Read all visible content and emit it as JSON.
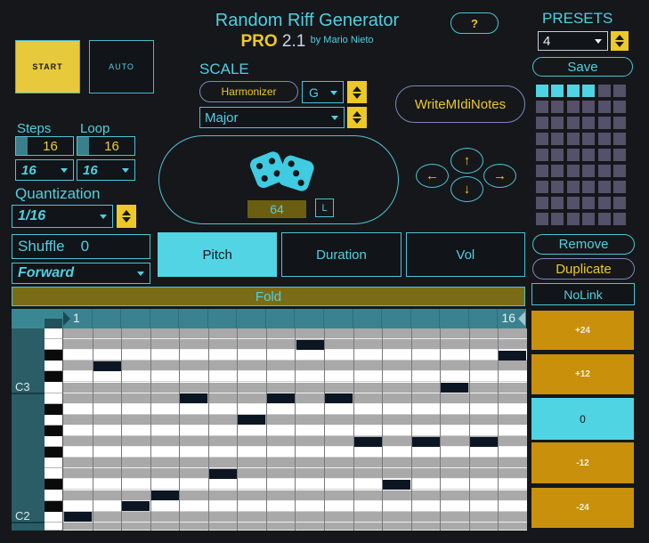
{
  "header": {
    "title": "Random Riff Generator",
    "edition": "PRO",
    "version": "2.1",
    "byline": "by Mario Nieto",
    "help": "?"
  },
  "transport": {
    "start": "START",
    "auto": "AUTO"
  },
  "scale": {
    "label": "SCALE",
    "harmonizer": "Harmonizer",
    "root": "G",
    "mode": "Major"
  },
  "write_midi_label": "WriteMIdiNotes",
  "presets": {
    "label": "PRESETS",
    "selected": "4",
    "save_label": "Save",
    "grid": {
      "cols": 6,
      "rows": 9,
      "active_count": 4
    }
  },
  "steps": {
    "label": "Steps",
    "value": "16",
    "select": "16"
  },
  "loop": {
    "label": "Loop",
    "value": "16",
    "select": "16"
  },
  "quantization": {
    "label": "Quantization",
    "value": "1/16"
  },
  "randomizer": {
    "value": "64",
    "lock_label": "L"
  },
  "shuffle": {
    "label": "Shuffle",
    "value": "0"
  },
  "direction": {
    "value": "Forward"
  },
  "tabs": [
    {
      "label": "Pitch",
      "active": true
    },
    {
      "label": "Duration",
      "active": false
    },
    {
      "label": "Vol",
      "active": false
    }
  ],
  "fold_label": "Fold",
  "nolink_label": "NoLink",
  "edit_actions": {
    "remove": "Remove",
    "duplicate": "Duplicate"
  },
  "transpose_buttons": [
    {
      "label": "+24",
      "active": false
    },
    {
      "label": "+12",
      "active": false
    },
    {
      "label": "0",
      "active": true
    },
    {
      "label": "-12",
      "active": false
    },
    {
      "label": "-24",
      "active": false
    }
  ],
  "piano_roll": {
    "timeline_start": "1",
    "timeline_end": "16",
    "steps": 16,
    "rows": [
      {
        "pitch": "F3",
        "key": "white"
      },
      {
        "pitch": "E3",
        "key": "white"
      },
      {
        "pitch": "D#3",
        "key": "black"
      },
      {
        "pitch": "D3",
        "key": "white"
      },
      {
        "pitch": "C#3",
        "key": "black"
      },
      {
        "pitch": "C3",
        "key": "white",
        "octave_label": "C3"
      },
      {
        "pitch": "B2",
        "key": "white"
      },
      {
        "pitch": "A#2",
        "key": "black"
      },
      {
        "pitch": "A2",
        "key": "white"
      },
      {
        "pitch": "G#2",
        "key": "black"
      },
      {
        "pitch": "G2",
        "key": "white"
      },
      {
        "pitch": "F#2",
        "key": "black"
      },
      {
        "pitch": "F2",
        "key": "white"
      },
      {
        "pitch": "E2",
        "key": "white"
      },
      {
        "pitch": "D#2",
        "key": "black"
      },
      {
        "pitch": "D2",
        "key": "white"
      },
      {
        "pitch": "C#2",
        "key": "black"
      },
      {
        "pitch": "C2",
        "key": "white",
        "octave_label": "C2"
      },
      {
        "pitch": "B1",
        "key": "white",
        "partial": true
      }
    ],
    "notes": [
      {
        "step": 1,
        "pitch": "C2"
      },
      {
        "step": 2,
        "pitch": "D3"
      },
      {
        "step": 3,
        "pitch": "C#2"
      },
      {
        "step": 4,
        "pitch": "D2"
      },
      {
        "step": 5,
        "pitch": "B2"
      },
      {
        "step": 6,
        "pitch": "E2"
      },
      {
        "step": 7,
        "pitch": "A2"
      },
      {
        "step": 8,
        "pitch": "B2"
      },
      {
        "step": 9,
        "pitch": "E3"
      },
      {
        "step": 10,
        "pitch": "B2"
      },
      {
        "step": 11,
        "pitch": "G2"
      },
      {
        "step": 12,
        "pitch": "D#2"
      },
      {
        "step": 13,
        "pitch": "G2"
      },
      {
        "step": 14,
        "pitch": "C3"
      },
      {
        "step": 15,
        "pitch": "G2"
      },
      {
        "step": 16,
        "pitch": "D#3"
      }
    ]
  },
  "colors": {
    "accent_cyan": "#52cfe0",
    "accent_yellow": "#edc928",
    "orange": "#c9900c",
    "olive": "#7a6c16",
    "timeline_teal": "#3a8290",
    "label_teal": "#2b5d66",
    "grid_gray": "#a9a9a9",
    "note_dark": "#0c1623",
    "preset_gray": "#55516a"
  }
}
